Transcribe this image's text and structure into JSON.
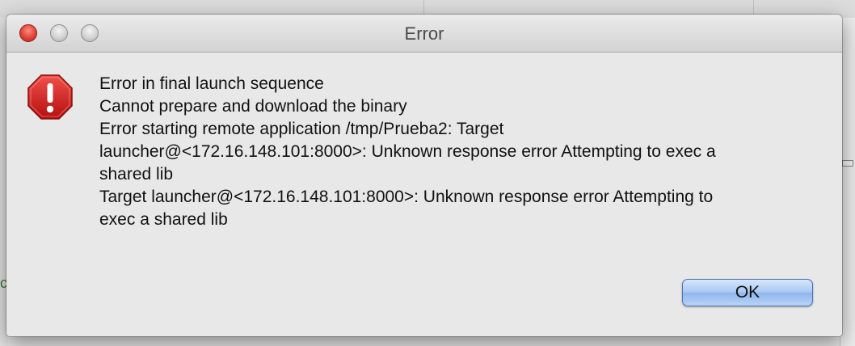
{
  "window": {
    "title": "Error"
  },
  "dialog": {
    "icon": "alert-octagon-icon",
    "icon_color": "#d81e1e",
    "message_lines": [
      "Error in final launch sequence",
      "Cannot prepare and download the binary",
      "Error starting remote application /tmp/Prueba2: Target",
      "launcher@<172.16.148.101:8000>: Unknown response error Attempting to exec a",
      "shared lib",
      "Target launcher@<172.16.148.101:8000>: Unknown response error Attempting to",
      "exec a shared lib"
    ],
    "ok_label": "OK"
  },
  "background": {
    "fragment_char": "c"
  }
}
